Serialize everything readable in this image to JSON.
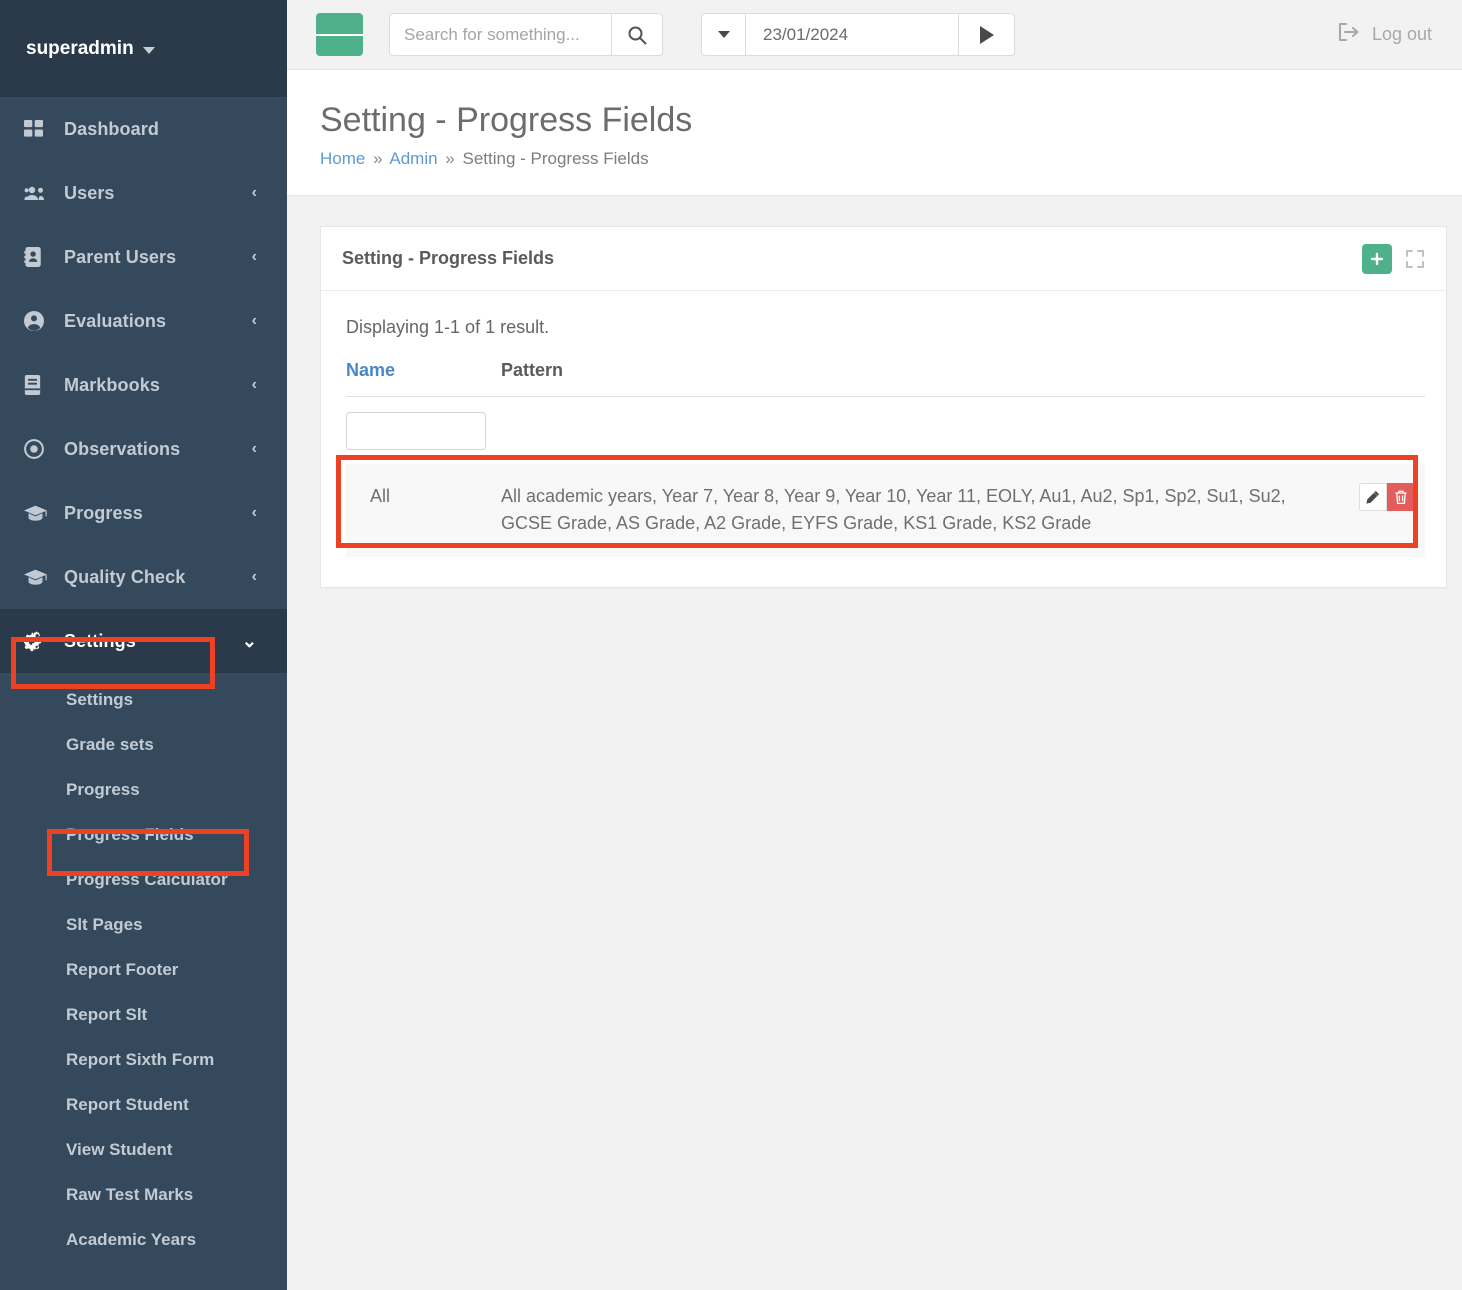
{
  "sidebar": {
    "user": {
      "name": "superadmin",
      "caret_icon": "caret-down-icon"
    },
    "items": [
      {
        "label": "Dashboard",
        "icon": "dashboard-grid-icon",
        "chevron": "",
        "active": false
      },
      {
        "label": "Users",
        "icon": "users-icon",
        "chevron": "‹",
        "active": false
      },
      {
        "label": "Parent Users",
        "icon": "address-book-icon",
        "chevron": "‹",
        "active": false
      },
      {
        "label": "Evaluations",
        "icon": "user-circle-icon",
        "chevron": "‹",
        "active": false
      },
      {
        "label": "Markbooks",
        "icon": "book-icon",
        "chevron": "‹",
        "active": false
      },
      {
        "label": "Observations",
        "icon": "target-icon",
        "chevron": "‹",
        "active": false
      },
      {
        "label": "Progress",
        "icon": "graduation-cap-icon",
        "chevron": "‹",
        "active": false
      },
      {
        "label": "Quality Check",
        "icon": "graduation-cap-icon",
        "chevron": "‹",
        "active": false
      },
      {
        "label": "Settings",
        "icon": "gears-icon",
        "chevron": "⌄",
        "active": true
      }
    ],
    "submenu": [
      {
        "label": "Settings",
        "highlighted": false
      },
      {
        "label": "Grade sets",
        "highlighted": false
      },
      {
        "label": "Progress",
        "highlighted": false
      },
      {
        "label": "Progress Fields",
        "highlighted": true
      },
      {
        "label": "Progress Calculator",
        "highlighted": false
      },
      {
        "label": "Slt Pages",
        "highlighted": false
      },
      {
        "label": "Report Footer",
        "highlighted": false
      },
      {
        "label": "Report Slt",
        "highlighted": false
      },
      {
        "label": "Report Sixth Form",
        "highlighted": false
      },
      {
        "label": "Report Student",
        "highlighted": false
      },
      {
        "label": "View Student",
        "highlighted": false
      },
      {
        "label": "Raw Test Marks",
        "highlighted": false
      },
      {
        "label": "Academic Years",
        "highlighted": false
      }
    ]
  },
  "topbar": {
    "menu_toggle_icon": "hamburger-icon",
    "search": {
      "placeholder": "Search for something...",
      "value": "",
      "button_icon": "search-icon"
    },
    "date": {
      "value": "23/01/2024",
      "dropdown_icon": "caret-down-icon",
      "go_icon": "play-icon"
    },
    "logout": {
      "label": "Log out",
      "icon": "sign-out-icon"
    }
  },
  "page": {
    "title": "Setting - Progress Fields",
    "breadcrumb": {
      "home": "Home",
      "admin": "Admin",
      "current": "Setting - Progress Fields",
      "separator": "»"
    }
  },
  "card": {
    "title": "Setting - Progress Fields",
    "add_icon": "plus-icon",
    "expand_icon": "expand-icon",
    "result_count": "Displaying 1-1 of 1 result.",
    "columns": {
      "name": "Name",
      "pattern": "Pattern"
    },
    "filters": {
      "name_value": "",
      "name_placeholder": ""
    },
    "rows": [
      {
        "name": "All",
        "pattern": "All academic years, Year 7, Year 8, Year 9, Year 10, Year 11, EOLY, Au1, Au2, Sp1, Sp2, Su1, Su2, GCSE Grade, AS Grade, A2 Grade, EYFS Grade, KS1 Grade, KS2 Grade",
        "edit_icon": "pencil-icon",
        "delete_icon": "trash-icon"
      }
    ]
  },
  "colors": {
    "sidebar_bg": "#35495c",
    "sidebar_header_bg": "#2b3a4a",
    "accent_green": "#4fb18c",
    "annotation_red": "#ec4125",
    "delete_red": "#e35d5d",
    "link_blue": "#4a86c8",
    "page_bg": "#f2f2f2"
  }
}
